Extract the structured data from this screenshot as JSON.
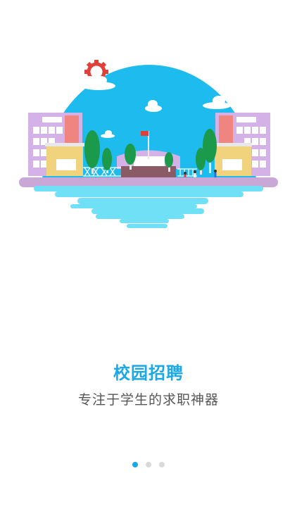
{
  "onboarding": {
    "illustration_icon": "campus-illustration",
    "title": "校园招聘",
    "subtitle": "专注于学生的求职神器",
    "pager": {
      "total": 3,
      "active_index": 0
    }
  },
  "colors": {
    "accent": "#1ba8e6",
    "subtext": "#555555",
    "dot_inactive": "#d9d9d9",
    "sky": "#1ebcee",
    "water": "#6fe0f5",
    "building_left": "#d4b1e6",
    "building_pink": "#f0857f",
    "building_yellow": "#f1d27d",
    "tree": "#1b9a4b",
    "ground": "#c9a8d8",
    "gear": "#e0403a"
  }
}
